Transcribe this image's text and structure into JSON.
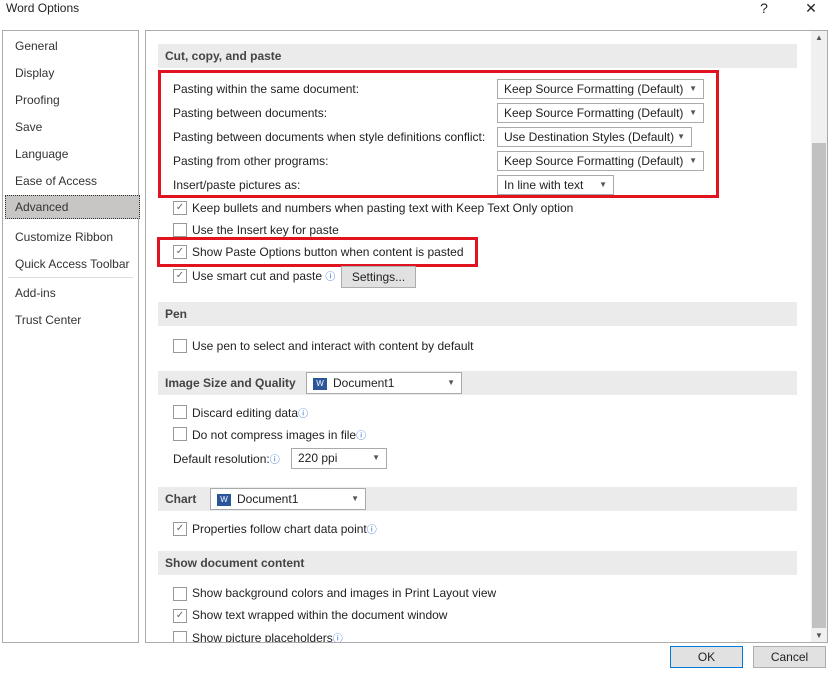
{
  "window": {
    "title": "Word Options",
    "help": "?",
    "close": "✕"
  },
  "sidebar": {
    "items": [
      "General",
      "Display",
      "Proofing",
      "Save",
      "Language",
      "Ease of Access",
      "Advanced",
      "Customize Ribbon",
      "Quick Access Toolbar",
      "Add-ins",
      "Trust Center"
    ],
    "active": "Advanced"
  },
  "cut_copy_paste": {
    "header": "Cut, copy, and paste",
    "rows": [
      {
        "label": "Pasting within the same document:",
        "value": "Keep Source Formatting (Default)"
      },
      {
        "label": "Pasting between documents:",
        "value": "Keep Source Formatting (Default)"
      },
      {
        "label": "Pasting between documents when style definitions conflict:",
        "value": "Use Destination Styles (Default)"
      },
      {
        "label": "Pasting from other programs:",
        "value": "Keep Source Formatting (Default)"
      },
      {
        "label": "Insert/paste pictures as:",
        "value": "In line with text"
      }
    ],
    "checks": [
      {
        "label": "Keep bullets and numbers when pasting text with Keep Text Only option",
        "checked": true
      },
      {
        "label": "Use the Insert key for paste",
        "checked": false
      },
      {
        "label": "Show Paste Options button when content is pasted",
        "checked": true
      },
      {
        "label": "Use smart cut and paste",
        "checked": true
      }
    ],
    "settings_button": "Settings..."
  },
  "pen": {
    "header": "Pen",
    "checks": [
      {
        "label": "Use pen to select and interact with content by default",
        "checked": false
      }
    ]
  },
  "image": {
    "header": "Image Size and Quality",
    "document": "Document1",
    "checks": [
      {
        "label": "Discard editing data",
        "checked": false
      },
      {
        "label": "Do not compress images in file",
        "checked": false
      }
    ],
    "resolution_label": "Default resolution:",
    "resolution": "220 ppi"
  },
  "chart": {
    "header": "Chart",
    "document": "Document1",
    "checks": [
      {
        "label": "Properties follow chart data point",
        "checked": true
      }
    ]
  },
  "show": {
    "header": "Show document content",
    "checks": [
      {
        "label": "Show background colors and images in Print Layout view",
        "checked": false
      },
      {
        "label": "Show text wrapped within the document window",
        "checked": true
      },
      {
        "label": "Show picture placeholders",
        "checked": false
      }
    ]
  },
  "footer": {
    "ok": "OK",
    "cancel": "Cancel"
  },
  "icons": {
    "check": "✓",
    "arrow": "▼",
    "info": "ⓘ",
    "doc": "W"
  },
  "colors": {
    "highlight": "#e0141e",
    "active_item": "#c8c6c4"
  }
}
